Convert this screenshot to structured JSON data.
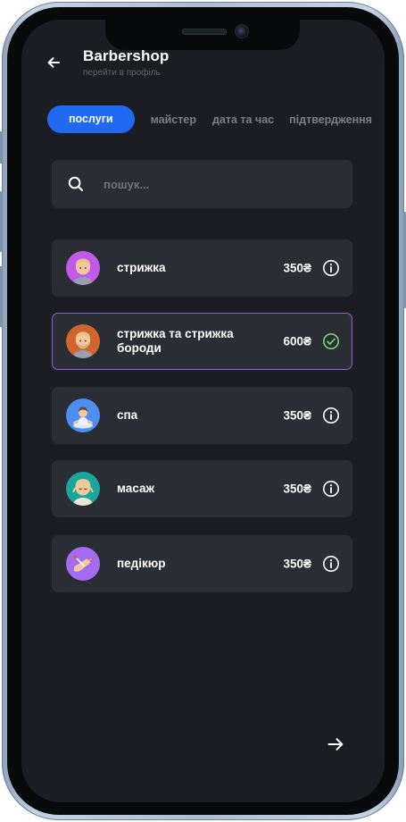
{
  "header": {
    "title": "Barbershop",
    "subtitle": "перейти в профіль",
    "back_icon": "arrow-left-icon"
  },
  "tabs": [
    {
      "label": "послуги",
      "active": true
    },
    {
      "label": "майстер",
      "active": false
    },
    {
      "label": "дата та час",
      "active": false
    },
    {
      "label": "підтвердження",
      "active": false
    }
  ],
  "search": {
    "placeholder": "пошук...",
    "value": "",
    "icon": "search-icon"
  },
  "services": [
    {
      "name": "стрижка",
      "price": "350₴",
      "avatar_color": "#c15ae8",
      "icon": "info-icon",
      "selected": false
    },
    {
      "name": "стрижка та стрижка бороди",
      "price": "600₴",
      "avatar_color": "#d0652e",
      "icon": "check-circle-icon",
      "selected": true
    },
    {
      "name": "спа",
      "price": "350₴",
      "avatar_color": "#4d8ff0",
      "icon": "info-icon",
      "selected": false
    },
    {
      "name": "масаж",
      "price": "350₴",
      "avatar_color": "#16a79a",
      "icon": "info-icon",
      "selected": false
    },
    {
      "name": "педікюр",
      "price": "350₴",
      "avatar_color": "#a36bf0",
      "icon": "info-icon",
      "selected": false
    }
  ],
  "footer": {
    "next_icon": "arrow-right-icon"
  },
  "colors": {
    "accent": "#1f6af0",
    "selected_border": "#8e5fd0",
    "check": "#6fd96f",
    "screen_bg": "#1c1d22",
    "card_bg": "#2b2d35"
  }
}
